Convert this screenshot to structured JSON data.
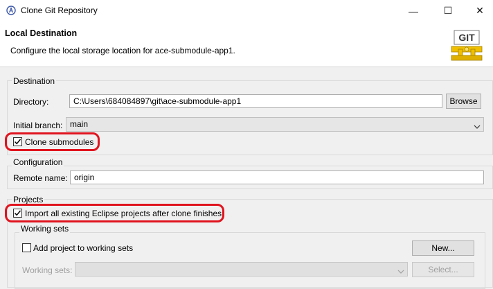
{
  "window": {
    "title": "Clone Git Repository",
    "minimize_glyph": "—",
    "maximize_glyph": "☐",
    "close_glyph": "✕"
  },
  "header": {
    "title": "Local Destination",
    "description": "Configure the local storage location for ace-submodule-app1.",
    "logo_text": "GIT"
  },
  "destination": {
    "group_label": "Destination",
    "directory_label": "Directory:",
    "directory_value": "C:\\Users\\684084897\\git\\ace-submodule-app1",
    "browse_label": "Browse",
    "initial_branch_label": "Initial branch:",
    "initial_branch_value": "main",
    "clone_submodules_label": "Clone submodules",
    "clone_submodules_checked": true
  },
  "configuration": {
    "group_label": "Configuration",
    "remote_name_label": "Remote name:",
    "remote_name_value": "origin"
  },
  "projects": {
    "group_label": "Projects",
    "import_label": "Import all existing Eclipse projects after clone finishes",
    "import_checked": true,
    "working_sets": {
      "group_label": "Working sets",
      "add_label": "Add project to working sets",
      "add_checked": false,
      "new_label": "New...",
      "working_sets_label": "Working sets:",
      "select_label": "Select..."
    }
  },
  "colors": {
    "highlight": "#e0141e",
    "checkmark": "#000000",
    "disabled_text": "#a0a0a0"
  }
}
